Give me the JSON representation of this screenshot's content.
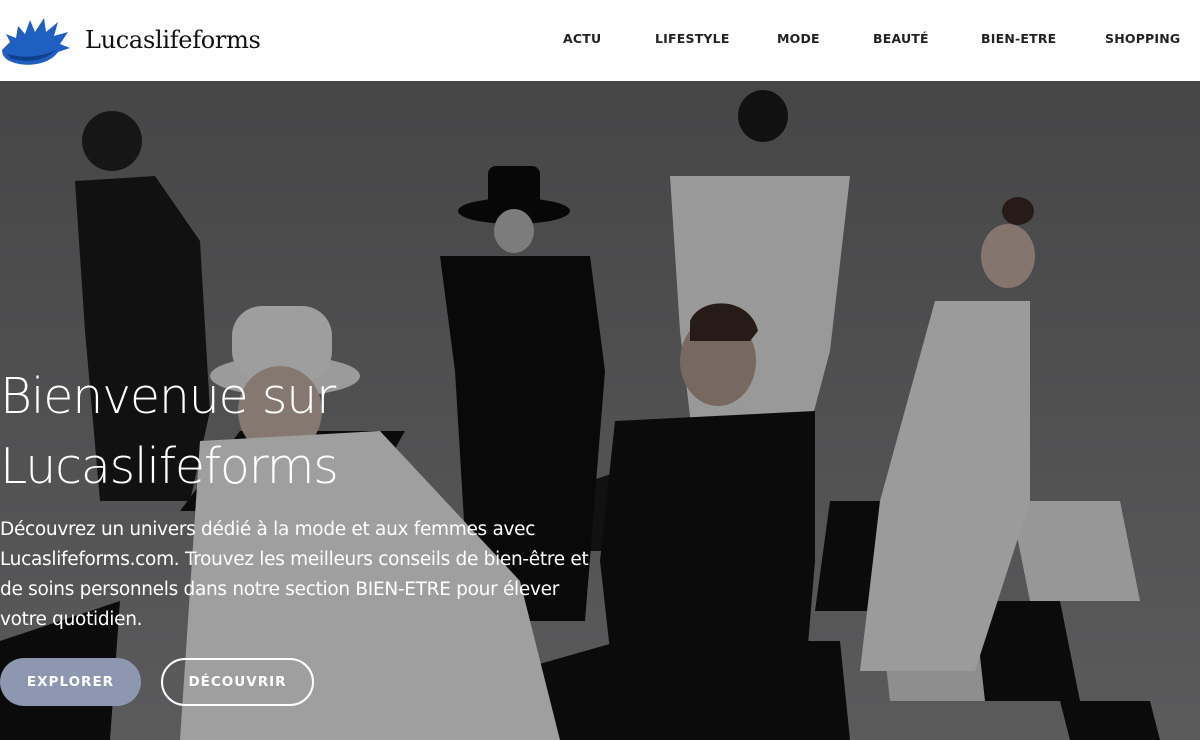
{
  "header": {
    "brand": "Lucaslifeforms",
    "nav": [
      "ACTU",
      "LIFESTYLE",
      "MODE",
      "BEAUTÉ",
      "BIEN-ETRE",
      "SHOPPING"
    ]
  },
  "hero": {
    "title_line1": "Bienvenue sur",
    "title_line2": "Lucaslifeforms",
    "description": "Découvrez un univers dédié à la mode et aux femmes avec Lucaslifeforms.com. Trouvez les meilleurs conseils de bien-être et de soins personnels dans notre section BIEN-ETRE pour élever votre quotidien.",
    "buttons": {
      "explore": "EXPLORER",
      "discover": "DÉCOUVRIR"
    }
  },
  "colors": {
    "accent": "#8e97b0",
    "logo_blue": "#1f5fbf",
    "header_bg": "#ffffff"
  }
}
